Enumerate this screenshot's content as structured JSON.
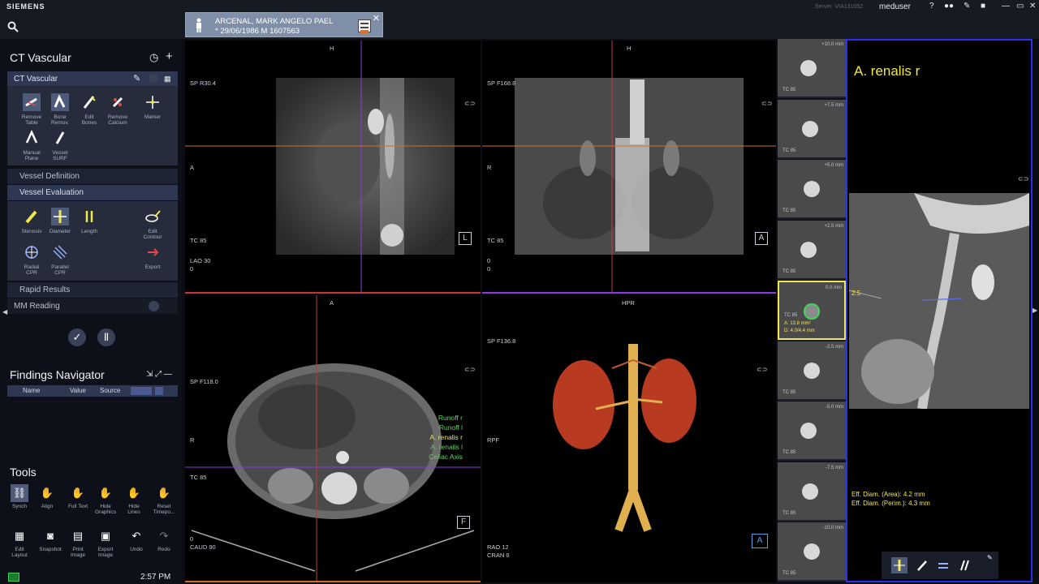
{
  "brand": "SIEMENS",
  "patient": {
    "name": "ARCENAL, MARK ANGELO PAEL",
    "info": "* 29/06/1986 M 1607563"
  },
  "server": "Server: VIA131052",
  "user": "meduser",
  "app_title": "CT Vascular",
  "subpanel_title": "CT Vascular",
  "tools_top": [
    {
      "label": "Remove\nTable",
      "icon": "remove-table-icon"
    },
    {
      "label": "Bone\nRemov.",
      "icon": "bone-remove-icon"
    },
    {
      "label": "Edit\nBones",
      "icon": "edit-bones-icon"
    },
    {
      "label": "Remove\nCalcium",
      "icon": "remove-calcium-icon"
    },
    {
      "label": "Marker",
      "icon": "marker-icon"
    },
    {
      "label": "Manual\nPlane",
      "icon": "manual-plane-icon"
    },
    {
      "label": "Vessel\nSURF",
      "icon": "vessel-surf-icon"
    }
  ],
  "sections": {
    "vessel_definition": "Vessel Definition",
    "vessel_evaluation": "Vessel Evaluation",
    "rapid_results": "Rapid Results",
    "mm_reading": "MM Reading"
  },
  "eval_tools": [
    {
      "label": "Stenosis"
    },
    {
      "label": "Diameter"
    },
    {
      "label": "Length"
    },
    {
      "label": "Edit\nContour"
    },
    {
      "label": "Radial\nCPR"
    },
    {
      "label": "Parallel\nCPR"
    },
    {
      "label": "Export"
    }
  ],
  "findings": {
    "title": "Findings Navigator",
    "columns": [
      "Name",
      "Value",
      "Source"
    ]
  },
  "tools_section": {
    "title": "Tools",
    "row1": [
      "Synch",
      "Align",
      "Full Text",
      "Hide\nGraphics",
      "Hide\nLines",
      "Reset\nTimepo..."
    ],
    "row2": [
      "Edit\nLayout",
      "Snapshot",
      "Print\nImage",
      "Export\nImage",
      "Undo",
      "Redo"
    ]
  },
  "clock": "2:57 PM",
  "viewports": {
    "v1": {
      "top": "H",
      "sp": "SP R30.4",
      "left": "A",
      "tc": "TC 85",
      "lao": "LAO 30",
      "zero": "0",
      "badge": "L"
    },
    "v2": {
      "top": "H",
      "sp": "SP F168.8",
      "left": "R",
      "tc": "TC 85",
      "z1": "0",
      "z2": "0",
      "badge": "A"
    },
    "v3": {
      "top": "A",
      "sp": "SP F118.0",
      "left": "R",
      "tc": "TC 85",
      "z1": "0",
      "caud": "CAUD 90",
      "badge": "F",
      "labels": [
        "Runoff r",
        "Runoff l",
        "A. renalis r",
        "A. renalis l",
        "Celiac Axis"
      ]
    },
    "v4": {
      "top": "HPR",
      "sp": "SP F136.8",
      "left": "RPF",
      "rao": "RAO 12",
      "cran": "CRAN 6",
      "badge": "A"
    }
  },
  "thumbs": [
    {
      "mm": "+10.0 mm",
      "tc": "TC 85"
    },
    {
      "mm": "+7.5 mm",
      "tc": "TC 85"
    },
    {
      "mm": "+5.0 mm",
      "tc": "TC 85"
    },
    {
      "mm": "+2.5 mm",
      "tc": "TC 85"
    },
    {
      "mm": "0.0 mm",
      "tc": "TC 85",
      "area": "A: 13.8 mm²",
      "diam": "D: 4.0/4.4 mm"
    },
    {
      "mm": "-2.5 mm",
      "tc": "TC 85"
    },
    {
      "mm": "-5.0 mm",
      "tc": "TC 85"
    },
    {
      "mm": "-7.5 mm",
      "tc": "TC 85"
    },
    {
      "mm": "-10.0 mm",
      "tc": "TC 85"
    }
  ],
  "right": {
    "title": "A. renalis r",
    "marker": "2.5",
    "eff1": "Eff. Diam. (Area): 4.2 mm",
    "eff2": "Eff. Diam. (Perim.): 4.3 mm"
  },
  "colors": {
    "accent": "#2a2ff0",
    "yellow": "#f0e84a",
    "green": "#5fd35f",
    "orange": "#e0801a"
  }
}
